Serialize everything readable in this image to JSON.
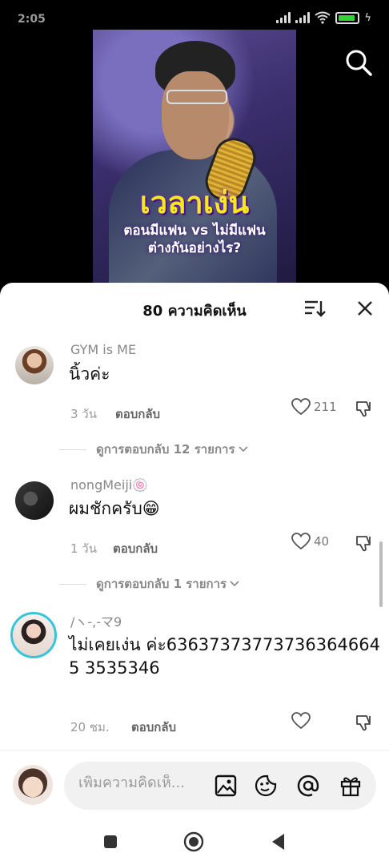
{
  "status_bar": {
    "time": "2:05"
  },
  "video": {
    "headline": "เวลาเง่น",
    "subtitle_line1": "ตอนมีแฟน vs ไม่มีแฟน",
    "subtitle_line2": "ต่างกันอย่างไร?"
  },
  "comments_header": {
    "title": "80 ความคิดเห็น"
  },
  "comments": [
    {
      "username": "GYM is ME",
      "text": "นิ้วค่ะ",
      "time": "3 วัน",
      "reply_label": "ตอบกลับ",
      "likes": "211",
      "view_replies": "ดูการตอบกลับ 12 รายการ"
    },
    {
      "username": "nongMeiji🍥",
      "text": "ผมชักครับ😁",
      "time": "1 วัน",
      "reply_label": "ตอบกลับ",
      "likes": "40",
      "view_replies": "ดูการตอบกลับ 1 รายการ"
    },
    {
      "username": "/ヽ-,-マ9",
      "text": "ไม่เคยเง่น ค่ะ636373737737363646645 3535346",
      "time": "20 ชม.",
      "reply_label": "ตอบกลับ",
      "likes": ""
    }
  ],
  "input": {
    "placeholder": "เพิ่มความคิดเห็..."
  },
  "colors": {
    "accent_yellow": "#f7e81e",
    "video_purple": "#3b2f6e",
    "battery_green": "#35d235"
  },
  "icons": {
    "search": "search-icon",
    "sort": "sort-icon",
    "close": "close-icon",
    "heart": "heart-icon",
    "dislike": "dislike-icon",
    "chevron": "chevron-down-icon",
    "image": "image-icon",
    "sticker": "sticker-icon",
    "mention": "mention-icon",
    "gift": "gift-icon"
  }
}
